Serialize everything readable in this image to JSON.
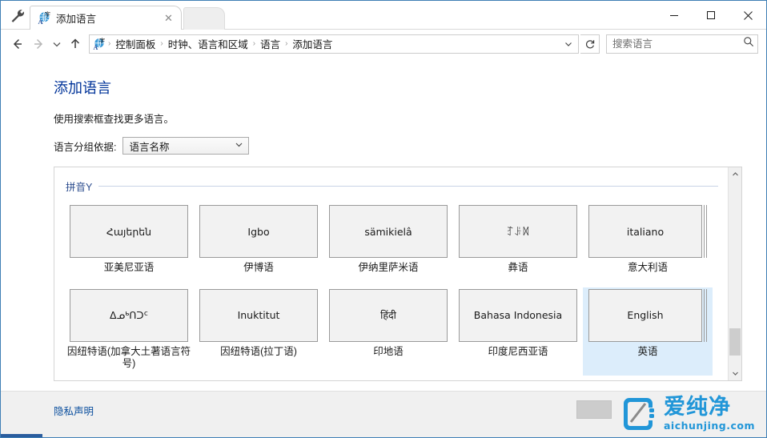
{
  "window": {
    "tab_title": "添加语言",
    "tab_close_glyph": "✕",
    "minimize_glyph": "—",
    "maximize_glyph": "▢",
    "close_glyph": "✕"
  },
  "nav": {
    "back_glyph": "←",
    "forward_glyph": "→",
    "history_glyph": "⌄",
    "up_glyph": "↑",
    "address_dropdown_glyph": "⌄",
    "refresh_glyph": "↻",
    "breadcrumbs": [
      "控制面板",
      "时钟、语言和区域",
      "语言",
      "添加语言"
    ],
    "separator": "›"
  },
  "search": {
    "placeholder": "搜索语言",
    "value": "",
    "icon": "search-icon"
  },
  "main": {
    "title": "添加语言",
    "subtitle": "使用搜索框查找更多语言。",
    "groupby_label": "语言分组依据:",
    "groupby_value": "语言名称",
    "groupby_caret": "⌄",
    "group_header": "拼音Y"
  },
  "languages": [
    {
      "native": "Հայերեն",
      "label": "亚美尼亚语",
      "stacked": false,
      "selected": false
    },
    {
      "native": "Igbo",
      "label": "伊博语",
      "stacked": false,
      "selected": false
    },
    {
      "native": "sämikielâ",
      "label": "伊纳里萨米语",
      "stacked": false,
      "selected": false
    },
    {
      "native": "ꆈꌠꉙ",
      "label": "彝语",
      "stacked": false,
      "selected": false
    },
    {
      "native": "italiano",
      "label": "意大利语",
      "stacked": true,
      "selected": false
    },
    {
      "native": "ᐃᓄᒃᑎᑐᑦ",
      "label": "因纽特语(加拿大土著语言符号)",
      "stacked": false,
      "selected": false
    },
    {
      "native": "Inuktitut",
      "label": "因纽特语(拉丁语)",
      "stacked": false,
      "selected": false
    },
    {
      "native": "हिंदी",
      "label": "印地语",
      "stacked": false,
      "selected": false
    },
    {
      "native": "Bahasa Indonesia",
      "label": "印度尼西亚语",
      "stacked": false,
      "selected": false
    },
    {
      "native": "English",
      "label": "英语",
      "stacked": true,
      "selected": true
    }
  ],
  "scrollbar": {
    "up_glyph": "⌃",
    "down_glyph": "⌄"
  },
  "footer": {
    "privacy_label": "隐私声明"
  },
  "watermark": {
    "cn": "爱纯净",
    "en": "aichunjing.com",
    "color": "#2196d8"
  }
}
